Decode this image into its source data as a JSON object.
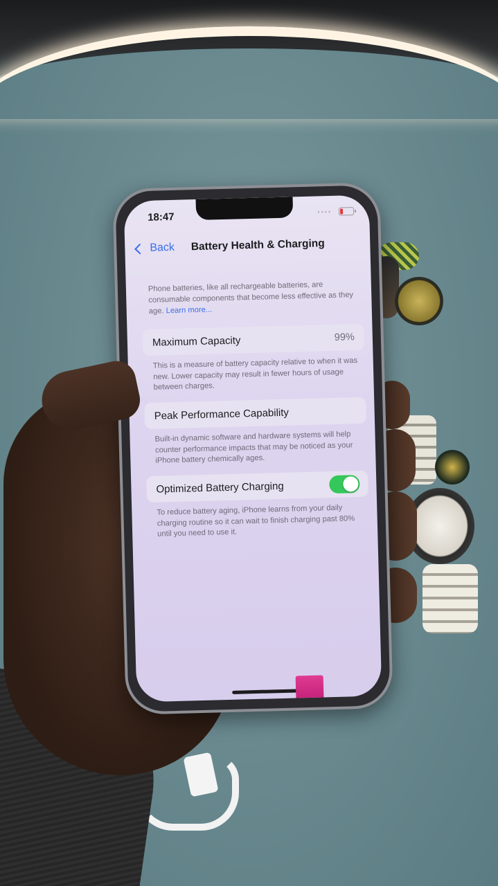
{
  "status_bar": {
    "time": "18:47"
  },
  "nav": {
    "back_label": "Back",
    "title": "Battery Health & Charging"
  },
  "intro": {
    "text": "Phone batteries, like all rechargeable batteries, are consumable components that become less effective as they age.",
    "link": "Learn more..."
  },
  "maximum_capacity": {
    "label": "Maximum Capacity",
    "value": "99%",
    "footnote": "This is a measure of battery capacity relative to when it was new. Lower capacity may result in fewer hours of usage between charges."
  },
  "peak_performance": {
    "label": "Peak Performance Capability",
    "footnote": "Built-in dynamic software and hardware systems will help counter performance impacts that may be noticed as your iPhone battery chemically ages."
  },
  "optimized_charging": {
    "label": "Optimized Battery Charging",
    "enabled": true,
    "toggle_color": "#34c759",
    "footnote": "To reduce battery aging, iPhone learns from your daily charging routine so it can wait to finish charging past 80% until you need to use it."
  },
  "colors": {
    "accent": "#3a6de8",
    "battery_low": "#e23b3b"
  }
}
